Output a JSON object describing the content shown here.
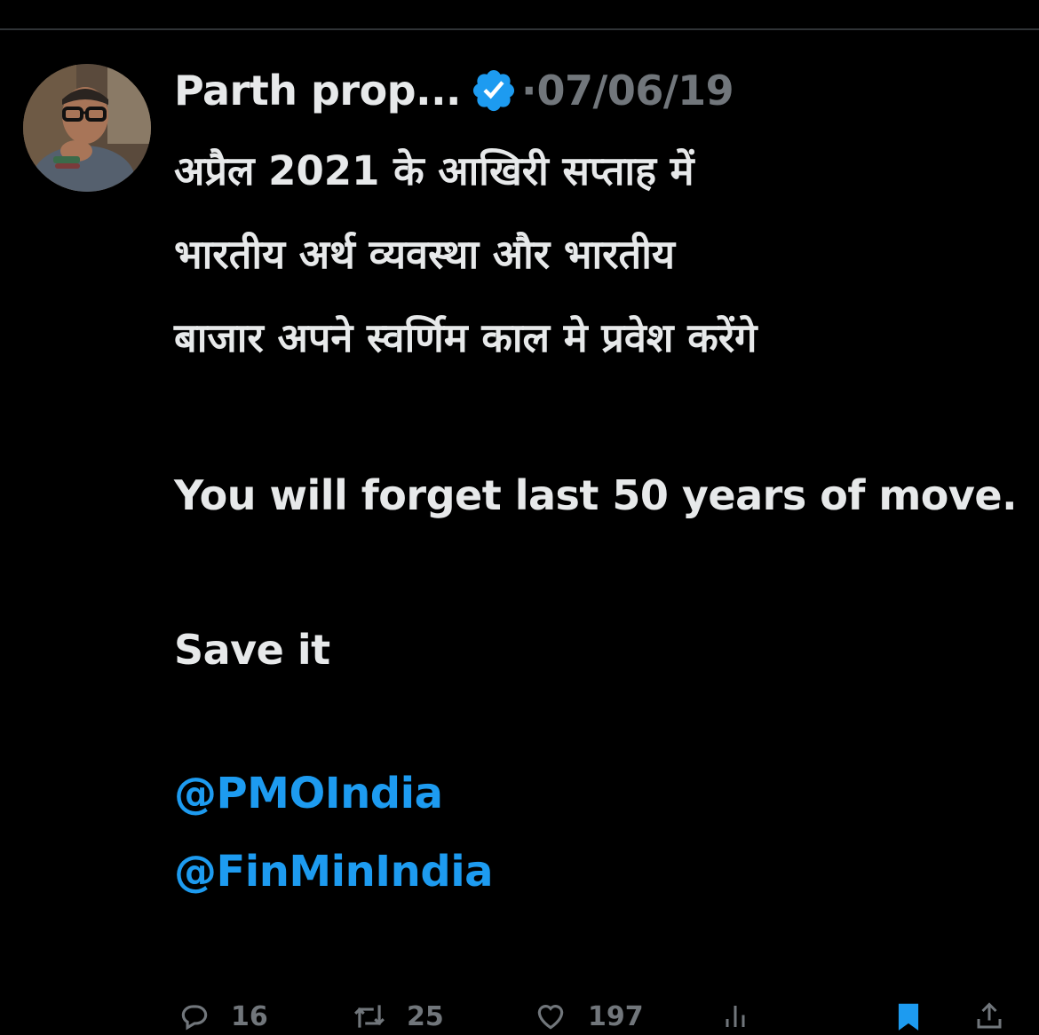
{
  "tweet": {
    "author_name": "Parth prop...",
    "separator": "·",
    "date": "07/06/19",
    "hindi_lines": [
      "अप्रैल 2021 के आखिरी सप्ताह में",
      "भारतीय अर्थ व्यवस्था और भारतीय",
      "बाजार अपने स्वर्णिम काल मे प्रवेश करेंगे"
    ],
    "english_text": "You will forget last 50 years of move.",
    "save_text": "Save it",
    "mentions": [
      "@PMOIndia",
      "@FinMinIndia"
    ]
  },
  "actions": {
    "reply_count": "16",
    "retweet_count": "25",
    "like_count": "197"
  },
  "colors": {
    "background": "#000000",
    "text": "#e7e9ea",
    "muted": "#71767b",
    "accent": "#1d9bf0"
  },
  "icons": {
    "verified": "verified-badge-icon",
    "reply": "reply-icon",
    "retweet": "retweet-icon",
    "like": "heart-icon",
    "views": "views-icon",
    "bookmark": "bookmark-icon",
    "share": "share-icon"
  }
}
